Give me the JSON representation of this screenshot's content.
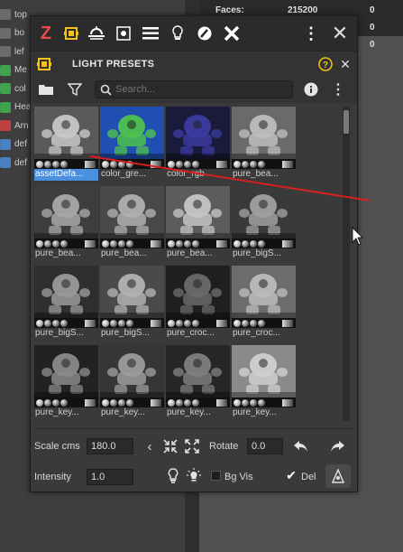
{
  "background": {
    "stats": [
      {
        "label": "Faces:",
        "value": "215200"
      }
    ],
    "right_values": [
      "0",
      "0",
      "0"
    ],
    "tree_items": [
      {
        "label": "top",
        "color": "#6b6b6b"
      },
      {
        "label": "bo",
        "color": "#6b6b6b"
      },
      {
        "label": "lef",
        "color": "#6b6b6b"
      },
      {
        "label": "Me",
        "color": "#3fa34d"
      },
      {
        "label": "col",
        "color": "#3fa34d"
      },
      {
        "label": "Hea",
        "color": "#3fa34d"
      },
      {
        "label": "Arn",
        "color": "#c04040"
      },
      {
        "label": "def",
        "color": "#4a7fc0"
      },
      {
        "label": "def",
        "color": "#4a7fc0"
      }
    ]
  },
  "toolbar": {
    "icons": [
      "zbrush-icon",
      "cube-icon",
      "light-horizon-icon",
      "sun-icon",
      "list-icon",
      "bulb-icon",
      "brush-icon",
      "tools-icon"
    ],
    "more_icon": "more-vert-icon",
    "close_icon": "close-icon"
  },
  "panel": {
    "title": "LIGHT PRESETS",
    "help_icon": "question-icon",
    "close_icon": "close-icon",
    "search_placeholder": "Search..."
  },
  "presets": [
    {
      "label": "assetDefa...",
      "tint": "#c8c8c8",
      "bg": "#5a5a5a",
      "active": true
    },
    {
      "label": "color_gre...",
      "tint": "#4fc14f",
      "bg": "#1f4fb0",
      "active": false
    },
    {
      "label": "color_rgb",
      "tint": "#3b3ba0",
      "bg": "#1a1a3a",
      "active": false
    },
    {
      "label": "pure_bea...",
      "tint": "#bdbdbd",
      "bg": "#6a6a6a",
      "active": false
    },
    {
      "label": "pure_bea...",
      "tint": "#a8a8a8",
      "bg": "#3e3e3e",
      "active": false
    },
    {
      "label": "pure_bea...",
      "tint": "#b0b0b0",
      "bg": "#494949",
      "active": false
    },
    {
      "label": "pure_bea...",
      "tint": "#c4c4c4",
      "bg": "#5c5c5c",
      "active": false
    },
    {
      "label": "pure_bigS...",
      "tint": "#a0a0a0",
      "bg": "#3a3a3a",
      "active": false
    },
    {
      "label": "pure_bigS...",
      "tint": "#9a9a9a",
      "bg": "#2f2f2f",
      "active": false
    },
    {
      "label": "pure_bigS...",
      "tint": "#b2b2b2",
      "bg": "#4a4a4a",
      "active": false
    },
    {
      "label": "pure_croc...",
      "tint": "#6a6a6a",
      "bg": "#1f1f1f",
      "active": false
    },
    {
      "label": "pure_croc...",
      "tint": "#bcbcbc",
      "bg": "#6c6c6c",
      "active": false
    },
    {
      "label": "pure_key...",
      "tint": "#8a8a8a",
      "bg": "#222222",
      "active": false
    },
    {
      "label": "pure_key...",
      "tint": "#9c9c9c",
      "bg": "#363636",
      "active": false
    },
    {
      "label": "pure_key...",
      "tint": "#7e7e7e",
      "bg": "#262626",
      "active": false
    },
    {
      "label": "pure_key...",
      "tint": "#cfcfcf",
      "bg": "#8a8a8a",
      "active": false
    }
  ],
  "controls": {
    "scale_label": "Scale cms",
    "scale_value": "180.0",
    "rotate_label": "Rotate",
    "rotate_value": "0.0",
    "intensity_label": "Intensity",
    "intensity_value": "1.0",
    "bgvis_label": "Bg Vis",
    "del_label": "Del"
  },
  "annotation": {
    "arrow_color": "#d62020"
  }
}
